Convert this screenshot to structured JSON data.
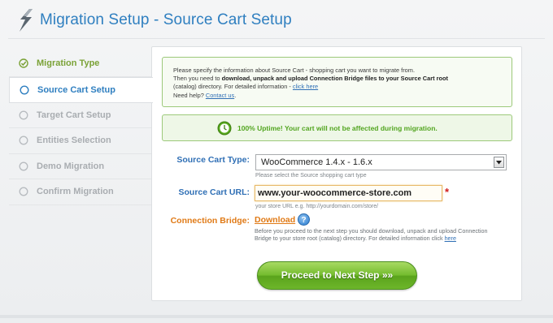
{
  "header": {
    "title": "Migration Setup - Source Cart Setup",
    "logo_icon": "lightning-logo-icon"
  },
  "sidebar": {
    "items": [
      {
        "label": "Migration Type",
        "state": "done"
      },
      {
        "label": "Source Cart Setup",
        "state": "active"
      },
      {
        "label": "Target Cart Setup",
        "state": "pending"
      },
      {
        "label": "Entities Selection",
        "state": "pending"
      },
      {
        "label": "Demo Migration",
        "state": "pending"
      },
      {
        "label": "Confirm Migration",
        "state": "pending"
      }
    ]
  },
  "info": {
    "line1": "Please specify the information about Source Cart - shopping cart you want to migrate from.",
    "line2_pre": "Then you need to ",
    "line2_bold": "download, unpack and upload Connection Bridge files to your Source Cart root",
    "line3_pre": "(catalog) directory. For detailed information - ",
    "line3_link": "click here",
    "line4_pre": "Need help? ",
    "line4_link": "Contact us",
    "line4_post": "."
  },
  "uptime": {
    "text": "100% Uptime! Your cart will not be affected during migration.",
    "icon": "clock-icon"
  },
  "form": {
    "source_type_label": "Source Cart Type:",
    "source_type_value": "WooCommerce 1.4.x - 1.6.x",
    "source_type_hint": "Please select the Source shopping cart type",
    "source_url_label": "Source Cart URL:",
    "source_url_value": "www.your-woocommerce-store.com",
    "source_url_hint": "your store URL e.g. http://yourdomain.com/store/",
    "required_mark": "*",
    "bridge_label": "Connection Bridge:",
    "download_label": "Download",
    "help_glyph": "?",
    "bridge_text_pre": "Before you proceed to the next step you should download, unpack and upload Connection Bridge to your store root (catalog) directory. For detailed information click ",
    "bridge_text_link": "here"
  },
  "actions": {
    "proceed_label": "Proceed to Next Step »»"
  },
  "colors": {
    "accent_blue": "#2f7fc0",
    "success_green": "#7aa236",
    "orange": "#e07a16",
    "button_green": "#72bb2d"
  }
}
